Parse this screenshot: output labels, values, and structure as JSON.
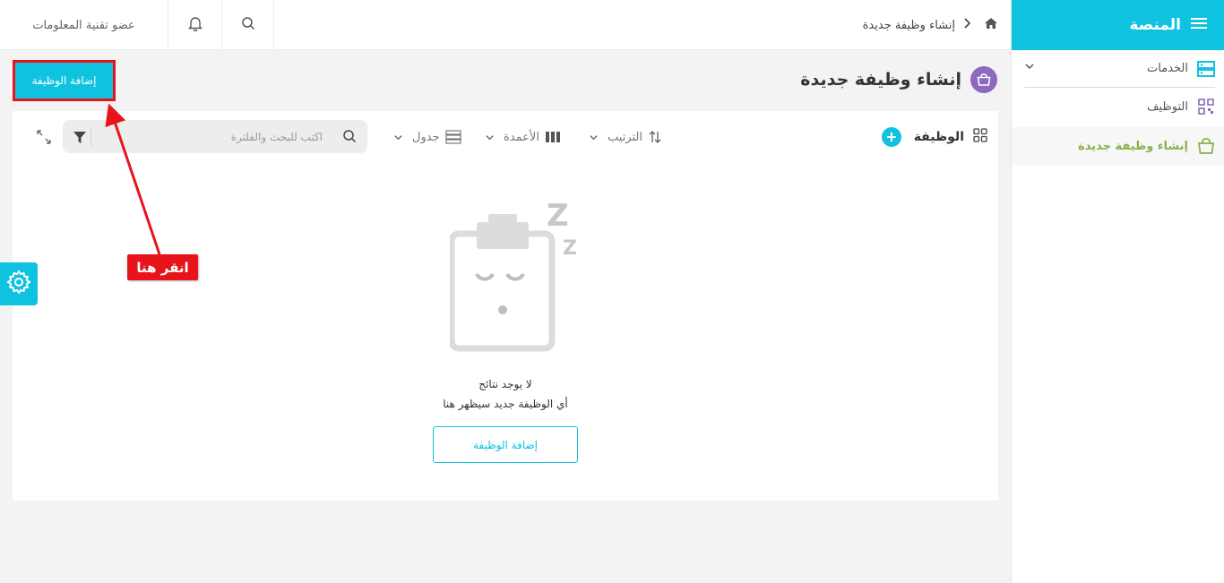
{
  "sidebar": {
    "title": "المنصة",
    "items": [
      {
        "label": "الخدمات"
      },
      {
        "label": "التوظيف"
      },
      {
        "label": "إنشاء وظيفة جديدة"
      }
    ]
  },
  "topbar": {
    "user": "عضو تقنية المعلومات",
    "breadcrumb": "إنشاء وظيفة جديدة"
  },
  "page": {
    "title": "إنشاء وظيفة جديدة",
    "add_button": "إضافة الوظيفة"
  },
  "toolbar": {
    "entity_label": "الوظيفة",
    "sort_label": "الترتيب",
    "columns_label": "الأعمدة",
    "view_label": "جدول",
    "search_placeholder": "اكتب للبحث والفلترة"
  },
  "empty": {
    "title": "لا يوجد نتائج",
    "subtitle": "أي الوظيفة جديد سيظهر هنا",
    "button": "إضافة الوظيفة"
  },
  "annotation": {
    "label": "انقر هنا"
  },
  "colors": {
    "accent": "#0fc3e0",
    "active_green": "#8bb04c",
    "annotation_red": "#e8141c",
    "badge_purple": "#8a6bbd"
  }
}
